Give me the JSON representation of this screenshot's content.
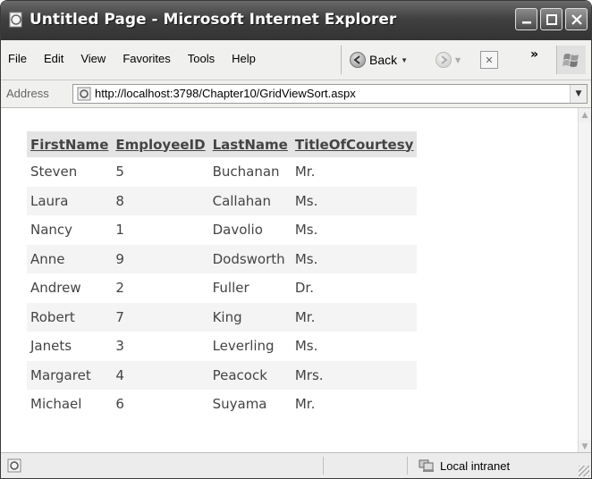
{
  "window": {
    "title": "Untitled Page - Microsoft Internet Explorer"
  },
  "menu": [
    "File",
    "Edit",
    "View",
    "Favorites",
    "Tools",
    "Help"
  ],
  "toolbar": {
    "back_label": "Back",
    "more": "»"
  },
  "address": {
    "label": "Address",
    "url": "http://localhost:3798/Chapter10/GridViewSort.aspx"
  },
  "grid": {
    "columns": [
      "FirstName",
      "EmployeeID",
      "LastName",
      "TitleOfCourtesy"
    ],
    "rows": [
      [
        "Steven",
        "5",
        "Buchanan",
        "Mr."
      ],
      [
        "Laura",
        "8",
        "Callahan",
        "Ms."
      ],
      [
        "Nancy",
        "1",
        "Davolio",
        "Ms."
      ],
      [
        "Anne",
        "9",
        "Dodsworth",
        "Ms."
      ],
      [
        "Andrew",
        "2",
        "Fuller",
        "Dr."
      ],
      [
        "Robert",
        "7",
        "King",
        "Mr."
      ],
      [
        "Janets",
        "3",
        "Leverling",
        "Ms."
      ],
      [
        "Margaret",
        "4",
        "Peacock",
        "Mrs."
      ],
      [
        "Michael",
        "6",
        "Suyama",
        "Mr."
      ]
    ]
  },
  "status": {
    "zone": "Local intranet"
  }
}
